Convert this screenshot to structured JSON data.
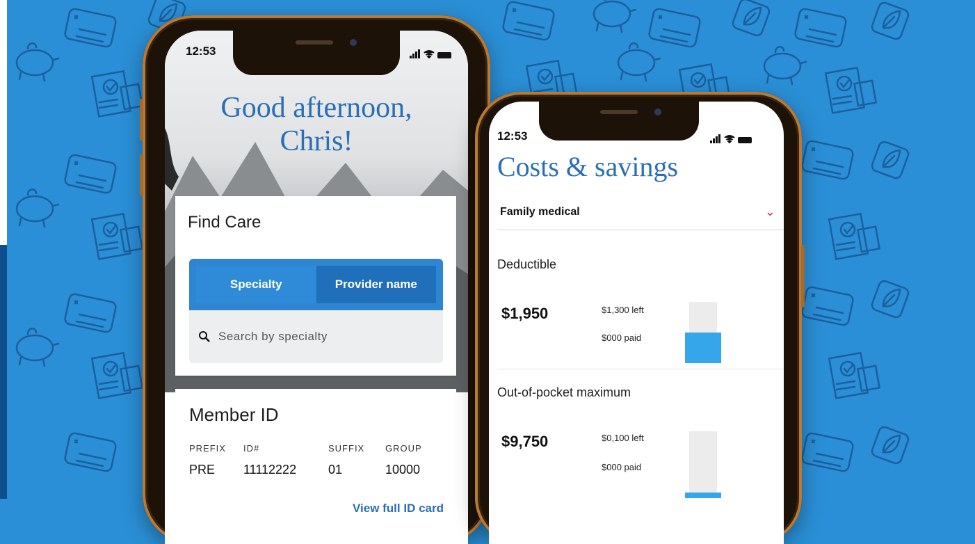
{
  "colors": {
    "background": "#2a8fd6",
    "accent_blue": "#2a6eb6",
    "tab_active": "#2f8bd8",
    "tab_inactive": "#1f6fba",
    "bar_fill": "#35a6ea",
    "chevron": "#d03030"
  },
  "phone_left": {
    "status_time": "12:53",
    "greeting_line1": "Good afternoon,",
    "greeting_line2": "Chris!",
    "find_care": {
      "title": "Find Care",
      "tabs": [
        "Specialty",
        "Provider name"
      ],
      "active_tab": "Specialty",
      "search_placeholder": "Search by specialty"
    },
    "member_id": {
      "title": "Member ID",
      "columns": [
        "PREFIX",
        "ID#",
        "SUFFIX",
        "GROUP"
      ],
      "values": [
        "PRE",
        "11112222",
        "01",
        "10000"
      ],
      "link": "View full ID card"
    }
  },
  "phone_right": {
    "status_time": "12:53",
    "title": "Costs & savings",
    "plan_select": "Family medical",
    "sections": [
      {
        "title": "Deductible",
        "amount": "$1,950",
        "left": "$1,300 left",
        "paid": "$000 paid",
        "paid_fraction": 0.5
      },
      {
        "title": "Out-of-pocket maximum",
        "amount": "$9,750",
        "left": "$0,100 left",
        "paid": "$000 paid",
        "paid_fraction": 0.08
      }
    ]
  },
  "icons": [
    "id-card-icon",
    "checklist-icon",
    "piggy-bank-icon",
    "leaf-icon",
    "search-icon",
    "chevron-down-icon",
    "signal-icon",
    "wifi-icon",
    "battery-icon"
  ]
}
